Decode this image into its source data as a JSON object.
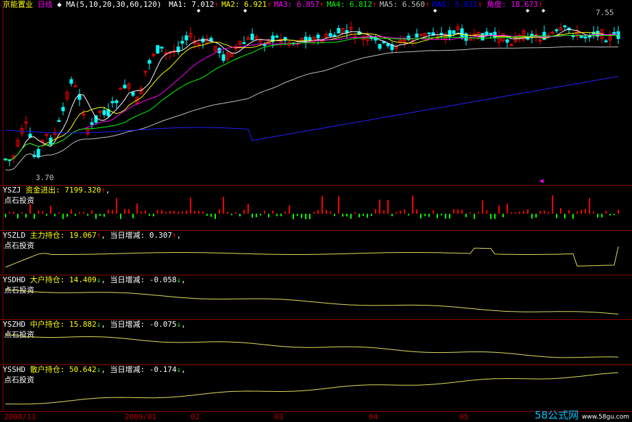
{
  "main": {
    "title": "京能置业",
    "period": "日线",
    "ma_label": "MA(5,10,20,30,60,120)",
    "ma": [
      {
        "name": "MA1",
        "value": "7.012",
        "arrow": "↑",
        "color": "#ffffff"
      },
      {
        "name": "MA2",
        "value": "6.921",
        "arrow": "↑",
        "color": "#ffff00"
      },
      {
        "name": "MA3",
        "value": "6.857",
        "arrow": "↑",
        "color": "#ff00ff"
      },
      {
        "name": "MA4",
        "value": "6.812",
        "arrow": "↑",
        "color": "#00ff00"
      },
      {
        "name": "MA5",
        "value": "6.560",
        "arrow": "↑",
        "color": "#c0c0c0"
      },
      {
        "name": "MA6",
        "value": "5.831",
        "arrow": "↑",
        "color": "#0000ff"
      }
    ],
    "angle_label": "角度",
    "angle_value": "18.673",
    "angle_arrow": "↑",
    "high_label": "7.55",
    "low_label": "3.70"
  },
  "panels": [
    {
      "code": "YSZJ",
      "name": "资金进出",
      "value": "7199.320",
      "arrow": "↑",
      "sub": "点石投资"
    },
    {
      "code": "YSZLD",
      "name": "主力持仓",
      "value": "19.067",
      "arrow": "↑",
      "extra_label": "当日增减",
      "extra_value": "0.307",
      "extra_arrow": "↑",
      "sub": "点石投资"
    },
    {
      "code": "YSDHD",
      "name": "大户持仓",
      "value": "14.409",
      "arrow": "↓",
      "extra_label": "当日增减",
      "extra_value": "-0.058",
      "extra_arrow": "↓",
      "sub": "点石投资"
    },
    {
      "code": "YSZHD",
      "name": "中户持仓",
      "value": "15.882",
      "arrow": "↓",
      "extra_label": "当日增减",
      "extra_value": "-0.075",
      "extra_arrow": "↓",
      "sub": "点石投资"
    },
    {
      "code": "YSSHD",
      "name": "散户持仓",
      "value": "50.642",
      "arrow": "↓",
      "extra_label": "当日增减",
      "extra_value": "-0.174",
      "extra_arrow": "↓",
      "sub": "点石投资"
    }
  ],
  "xaxis": [
    "2008/11",
    "2009/01",
    "02",
    "03",
    "04",
    "05"
  ],
  "watermark": {
    "brand": "58公式网",
    "url": "www.58gu.com"
  },
  "colors": {
    "up": "#ff0000",
    "down": "#00ffff",
    "frame": "#8b0000",
    "label": "#ffff00"
  }
}
